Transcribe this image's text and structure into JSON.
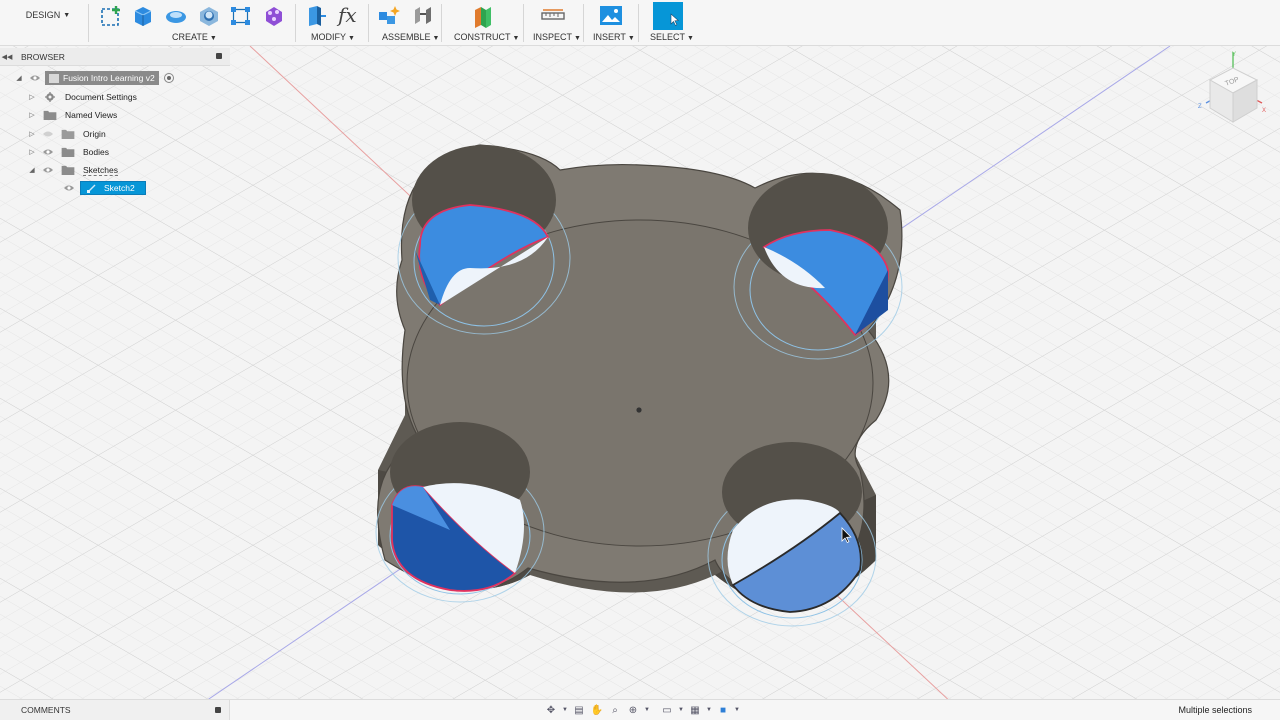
{
  "toolbar": {
    "workspace": "DESIGN",
    "groups": [
      {
        "label": "CREATE"
      },
      {
        "label": "MODIFY"
      },
      {
        "label": "ASSEMBLE"
      },
      {
        "label": "CONSTRUCT"
      },
      {
        "label": "INSPECT"
      },
      {
        "label": "INSERT"
      },
      {
        "label": "SELECT"
      }
    ]
  },
  "browser": {
    "title": "BROWSER",
    "items": [
      {
        "label": "Fusion Intro Learning v2",
        "icon": "document-icon"
      },
      {
        "label": "Document Settings",
        "icon": "gear-icon"
      },
      {
        "label": "Named Views",
        "icon": "folder-icon"
      },
      {
        "label": "Origin",
        "icon": "folder-icon"
      },
      {
        "label": "Bodies",
        "icon": "folder-icon"
      },
      {
        "label": "Sketches",
        "icon": "folder-icon"
      },
      {
        "label": "Sketch2",
        "icon": "sketch-icon"
      }
    ]
  },
  "viewcube": {
    "face": "TOP",
    "axis_x": "X",
    "axis_y": "Y",
    "axis_z": "Z"
  },
  "comments": {
    "label": "COMMENTS"
  },
  "status": {
    "text": "Multiple selections"
  },
  "colors": {
    "accent": "#0696d7",
    "selected": "#2e7fd6",
    "model": "#7f7a72",
    "sketch_line": "#e0325f"
  }
}
